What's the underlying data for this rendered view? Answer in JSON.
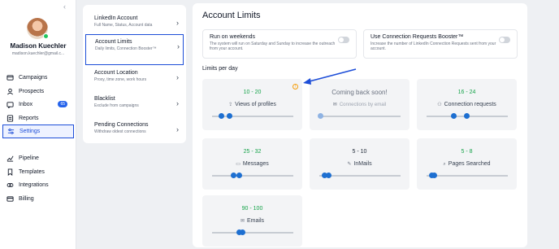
{
  "sidebar": {
    "collapse_glyph": "‹",
    "user": {
      "name": "Madison Kuechler",
      "email": "madison.kuechler@gmail.c..."
    },
    "items": [
      {
        "label": "Campaigns",
        "icon": "campaigns-icon"
      },
      {
        "label": "Prospects",
        "icon": "prospects-icon"
      },
      {
        "label": "Inbox",
        "icon": "inbox-icon",
        "badge": "65"
      },
      {
        "label": "Reports",
        "icon": "reports-icon"
      },
      {
        "label": "Settings",
        "icon": "settings-icon",
        "active": true
      },
      {
        "label": "Pipeline",
        "icon": "pipeline-icon"
      },
      {
        "label": "Templates",
        "icon": "templates-icon"
      },
      {
        "label": "Integrations",
        "icon": "integrations-icon"
      },
      {
        "label": "Billing",
        "icon": "billing-icon"
      }
    ]
  },
  "submenu": {
    "items": [
      {
        "title": "LinkedIn Account",
        "subtitle": "Full Name, Status, Account data"
      },
      {
        "title": "Account Limits",
        "subtitle": "Daily limits, Connection Booster™",
        "active": true
      },
      {
        "title": "Account Location",
        "subtitle": "Proxy, time zone, work hours"
      },
      {
        "title": "Blacklist",
        "subtitle": "Exclude from campaigns"
      },
      {
        "title": "Pending Connections",
        "subtitle": "Withdraw oldest connections"
      }
    ]
  },
  "main": {
    "title": "Account Limits",
    "toggles": [
      {
        "title": "Run on weekends",
        "description": "The system will run on Saturday and Sunday to increase the outreach from your account.",
        "enabled": false
      },
      {
        "title": "Use Connection Requests Booster™",
        "description": "Increase the number of LinkedIn Connection Requests sent from your account.",
        "enabled": false
      }
    ],
    "limits_title": "Limits per day",
    "limits": [
      {
        "range": "10 - 20",
        "label": "Views of profiles",
        "icon": "views-icon",
        "warning": true,
        "range_color": "#16a34a",
        "low": 0.1,
        "high": 0.2
      },
      {
        "range": "Coming back soon!",
        "label": "Connections by email",
        "icon": "email-connections-icon",
        "disabled": true,
        "low": 0.0,
        "high": 0.0
      },
      {
        "range": "16 - 24",
        "label": "Connection requests",
        "icon": "connection-requests-icon",
        "range_color": "#16a34a",
        "low": 0.32,
        "high": 0.48
      },
      {
        "range": "25 - 32",
        "label": "Messages",
        "icon": "messages-icon",
        "range_color": "#16a34a",
        "low": 0.25,
        "high": 0.32
      },
      {
        "range": "5 - 10",
        "label": "InMails",
        "icon": "inmails-icon",
        "range_color": "#1f2937",
        "low": 0.05,
        "high": 0.1
      },
      {
        "range": "5 - 8",
        "label": "Pages Searched",
        "icon": "pages-searched-icon",
        "range_color": "#16a34a",
        "low": 0.05,
        "high": 0.08
      },
      {
        "range": "90 - 100",
        "label": "Emails",
        "icon": "emails-icon",
        "range_color": "#16a34a",
        "low": 0.32,
        "high": 0.36
      }
    ]
  },
  "colors": {
    "accent": "#1d4ed8",
    "range_green": "#16a34a",
    "slider_blue": "#1d6fd1",
    "annotation": "#1d4ed8"
  }
}
